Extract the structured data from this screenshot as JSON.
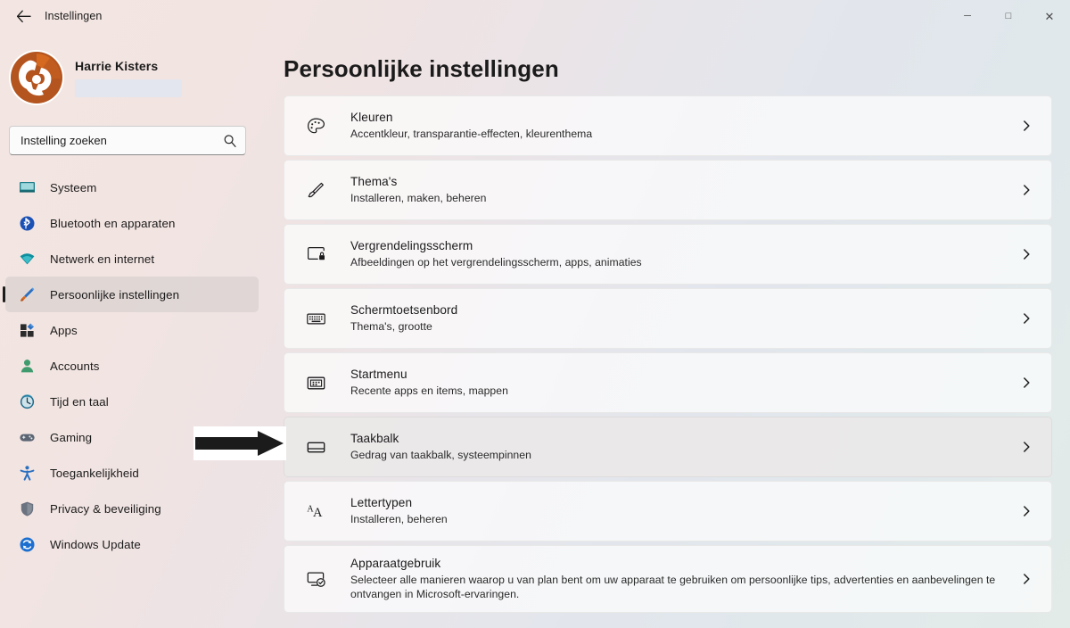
{
  "window": {
    "title": "Instellingen",
    "back_icon": "arrow-left-icon",
    "controls": {
      "minimize": "─",
      "maximize": "□",
      "close": "✕"
    }
  },
  "account": {
    "name": "Harrie Kisters",
    "email_redacted": true,
    "avatar_icon": "user-avatar"
  },
  "search": {
    "placeholder": "Instelling zoeken",
    "value": "",
    "icon": "search-icon"
  },
  "sidebar": {
    "items": [
      {
        "label": "Systeem",
        "icon": "monitor-icon",
        "active": false
      },
      {
        "label": "Bluetooth en apparaten",
        "icon": "bluetooth-icon",
        "active": false
      },
      {
        "label": "Netwerk en internet",
        "icon": "wifi-icon",
        "active": false
      },
      {
        "label": "Persoonlijke instellingen",
        "icon": "paintbrush-icon",
        "active": true
      },
      {
        "label": "Apps",
        "icon": "apps-icon",
        "active": false
      },
      {
        "label": "Accounts",
        "icon": "person-icon",
        "active": false
      },
      {
        "label": "Tijd en taal",
        "icon": "clock-icon",
        "active": false
      },
      {
        "label": "Gaming",
        "icon": "gamepad-icon",
        "active": false
      },
      {
        "label": "Toegankelijkheid",
        "icon": "accessibility-icon",
        "active": false
      },
      {
        "label": "Privacy & beveiliging",
        "icon": "shield-icon",
        "active": false
      },
      {
        "label": "Windows Update",
        "icon": "update-icon",
        "active": false
      }
    ]
  },
  "main": {
    "title": "Persoonlijke instellingen",
    "cards": [
      {
        "title": "Kleuren",
        "subtitle": "Accentkleur, transparantie-effecten, kleurenthema",
        "icon": "palette-icon",
        "hover": false
      },
      {
        "title": "Thema's",
        "subtitle": "Installeren, maken, beheren",
        "icon": "brush-icon",
        "hover": false
      },
      {
        "title": "Vergrendelingsscherm",
        "subtitle": "Afbeeldingen op het vergrendelingsscherm, apps, animaties",
        "icon": "lockscreen-icon",
        "hover": false
      },
      {
        "title": "Schermtoetsenbord",
        "subtitle": "Thema's, grootte",
        "icon": "keyboard-icon",
        "hover": false
      },
      {
        "title": "Startmenu",
        "subtitle": "Recente apps en items, mappen",
        "icon": "startmenu-icon",
        "hover": false
      },
      {
        "title": "Taakbalk",
        "subtitle": "Gedrag van taakbalk, systeempinnen",
        "icon": "taskbar-icon",
        "hover": true
      },
      {
        "title": "Lettertypen",
        "subtitle": "Installeren, beheren",
        "icon": "fonts-icon",
        "hover": false
      },
      {
        "title": "Apparaatgebruik",
        "subtitle": "Selecteer alle manieren waarop u van plan bent om uw apparaat te gebruiken om persoonlijke tips, advertenties en aanbevelingen te ontvangen in Microsoft-ervaringen.",
        "icon": "device-usage-icon",
        "hover": false
      }
    ],
    "chevron_icon": "chevron-right-icon"
  },
  "annotation": {
    "arrow_icon": "arrow-right-annotation",
    "points_at": "Taakbalk"
  },
  "colors": {
    "text": "#1b1b1b",
    "accent_avatar": "#b4541f",
    "bluetooth": "#1b51b4",
    "wifi": "#0e8f9e",
    "person": "#3f9b6d",
    "update": "#1c6fd0",
    "accessibility": "#2a6fc0"
  }
}
